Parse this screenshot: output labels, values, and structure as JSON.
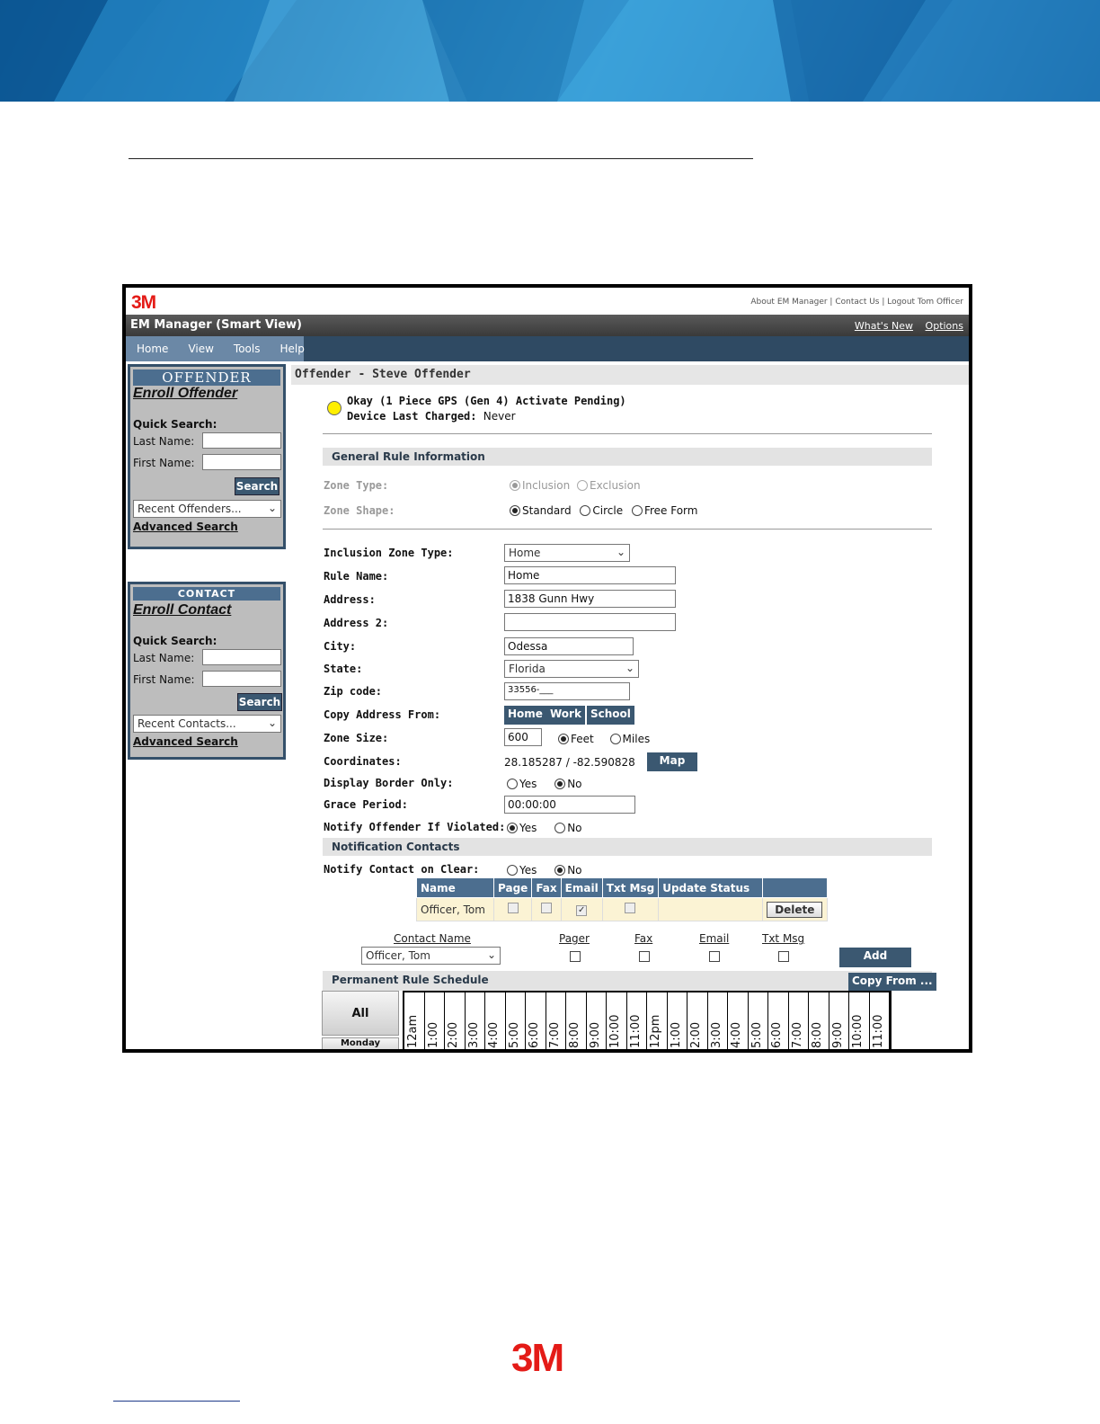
{
  "brand": {
    "logo": "3M",
    "footer_logo": "3M",
    "accent": "#e41b17",
    "nav_color": "#4c6e8f"
  },
  "toplinks": "About EM Manager | Contact Us | Logout Tom Officer",
  "app_title": "EM Manager (Smart View)",
  "title_links": {
    "whats_new": "What's New",
    "options": "Options"
  },
  "menu": {
    "home": "Home",
    "view": "View",
    "tools": "Tools",
    "help": "Help"
  },
  "offender_panel": {
    "header": "OFFENDER",
    "enroll": "Enroll Offender",
    "quick_search": "Quick Search:",
    "last_name": "Last Name:",
    "first_name": "First Name:",
    "search": "Search",
    "recent": "Recent Offenders...",
    "advanced": "Advanced Search"
  },
  "contact_panel": {
    "header": "CONTACT",
    "enroll": "Enroll Contact",
    "quick_search": "Quick Search:",
    "last_name": "Last Name:",
    "first_name": "First Name:",
    "search": "Search",
    "recent": "Recent Contacts...",
    "advanced": "Advanced Search"
  },
  "offender_header": "Offender - Steve Offender",
  "status": {
    "line1": "Okay (1 Piece GPS (Gen 4) Activate Pending)",
    "charged_label": "Device Last Charged:",
    "charged_value": "Never",
    "indicator_color": "#ffef00"
  },
  "general": {
    "section": "General Rule Information",
    "zone_type_label": "Zone Type:",
    "inclusion": "Inclusion",
    "exclusion": "Exclusion",
    "zone_shape_label": "Zone Shape:",
    "standard": "Standard",
    "circle": "Circle",
    "free_form": "Free Form"
  },
  "form": {
    "inclusion_zone_type_label": "Inclusion Zone Type:",
    "inclusion_zone_type": "Home",
    "rule_name_label": "Rule Name:",
    "rule_name": "Home",
    "address_label": "Address:",
    "address": "1838 Gunn Hwy",
    "address2_label": "Address 2:",
    "address2": "",
    "city_label": "City:",
    "city": "Odessa",
    "state_label": "State:",
    "state": "Florida",
    "zip_label": "Zip code:",
    "zip": "33556-___",
    "copy_label": "Copy Address From:",
    "copy_home": "Home",
    "copy_work": "Work",
    "copy_school": "School",
    "zone_size_label": "Zone Size:",
    "zone_size": "600",
    "feet": "Feet",
    "miles": "Miles",
    "coordinates_label": "Coordinates:",
    "coordinates": "28.185287 / -82.590828",
    "map": "Map",
    "border_label": "Display Border Only:",
    "yes": "Yes",
    "no": "No",
    "grace_label": "Grace Period:",
    "grace": "00:00:00",
    "notify_label": "Notify Offender If Violated:"
  },
  "notifications": {
    "section": "Notification Contacts",
    "clear_label": "Notify Contact on Clear:",
    "columns": [
      "Name",
      "Page",
      "Fax",
      "Email",
      "Txt Msg",
      "Update Status",
      ""
    ],
    "row": {
      "name": "Officer, Tom",
      "delete": "Delete"
    },
    "add_headers": {
      "contact_name": "Contact Name",
      "pager": "Pager",
      "fax": "Fax",
      "email": "Email",
      "txt": "Txt Msg"
    },
    "contact_select": "Officer, Tom",
    "add": "Add"
  },
  "schedule": {
    "section": "Permanent Rule Schedule",
    "copy_from": "Copy From ...",
    "all": "All",
    "monday": "Monday",
    "hours": [
      "12am",
      "1:00",
      "2:00",
      "3:00",
      "4:00",
      "5:00",
      "6:00",
      "7:00",
      "8:00",
      "9:00",
      "10:00",
      "11:00",
      "12pm",
      "1:00",
      "2:00",
      "3:00",
      "4:00",
      "5:00",
      "6:00",
      "7:00",
      "8:00",
      "9:00",
      "10:00",
      "11:00"
    ]
  }
}
